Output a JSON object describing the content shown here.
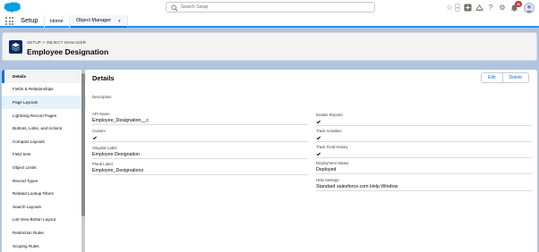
{
  "global_header": {
    "search": {
      "placeholder": "Search Setup",
      "value": ""
    },
    "notification_count": "11",
    "icons": [
      "favorites-star-icon",
      "favorites-dropdown-icon",
      "global-actions-plus-icon",
      "trailhead-icon",
      "help-icon",
      "setup-gear-icon",
      "notifications-bell-icon",
      "user-avatar"
    ]
  },
  "context_bar": {
    "app_name": "Setup",
    "tabs": [
      {
        "label": "Home"
      },
      {
        "label": "Object Manager"
      }
    ]
  },
  "page_header": {
    "breadcrumb": "SETUP > OBJECT MANAGER",
    "title": "Employee Designation",
    "icon": "layers-icon"
  },
  "sidebar": {
    "items": [
      {
        "label": "Details"
      },
      {
        "label": "Fields & Relationships"
      },
      {
        "label": "Page Layouts"
      },
      {
        "label": "Lightning Record Pages"
      },
      {
        "label": "Buttons, Links, and Actions"
      },
      {
        "label": "Compact Layouts"
      },
      {
        "label": "Field Sets"
      },
      {
        "label": "Object Limits"
      },
      {
        "label": "Record Types"
      },
      {
        "label": "Related Lookup Filters"
      },
      {
        "label": "Search Layouts"
      },
      {
        "label": "List View Button Layout"
      },
      {
        "label": "Restriction Rules"
      },
      {
        "label": "Scoping Rules"
      }
    ]
  },
  "details": {
    "title": "Details",
    "edit_label": "Edit",
    "delete_label": "Delete",
    "description_label": "Description",
    "left_fields": [
      {
        "label": "API Name",
        "value": "Employee_Designation__c"
      },
      {
        "label": "Custom",
        "value": ""
      },
      {
        "label": "Singular Label",
        "value": "Employee Designation"
      },
      {
        "label": "Plural Label",
        "value": "Employee_Designations"
      }
    ],
    "right_fields": [
      {
        "label": "Enable Reports",
        "value": ""
      },
      {
        "label": "Track Activities",
        "value": ""
      },
      {
        "label": "Track Field History",
        "value": ""
      },
      {
        "label": "Deployment Status",
        "value": "Deployed"
      },
      {
        "label": "Help Settings",
        "value": "Standard salesforce.com Help Window"
      }
    ]
  },
  "colors": {
    "brand_blue": "#0176d3",
    "navy": "#032d60",
    "page_bg": "#b0c4df",
    "badge_red": "#c23934"
  }
}
